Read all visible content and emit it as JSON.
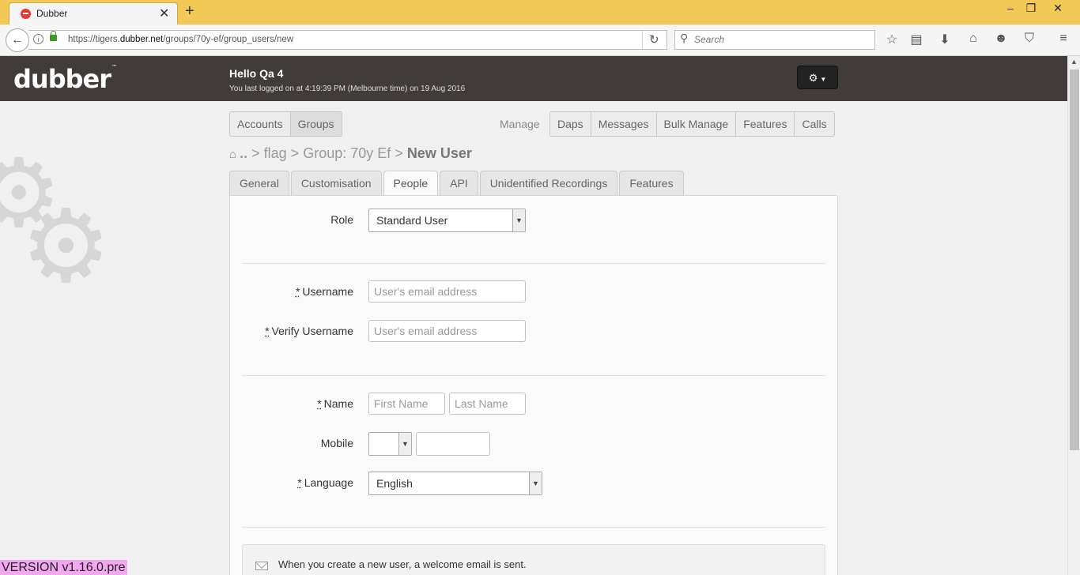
{
  "browser": {
    "tab_title": "Dubber",
    "url_prefix": "https://tigers.",
    "url_domain": "dubber.net",
    "url_path": "/groups/70y-ef/group_users/new",
    "search_placeholder": "Search"
  },
  "header": {
    "logo": "dubber",
    "logo_tm": "™",
    "greeting": "Hello Qa 4",
    "last_login": "You last logged on at 4:19:39 PM (Melbourne time) on 19 Aug 2016"
  },
  "nav": {
    "left": [
      "Accounts",
      "Groups"
    ],
    "manage_label": "Manage",
    "right": [
      "Daps",
      "Messages",
      "Bulk Manage",
      "Features",
      "Calls"
    ]
  },
  "breadcrumb": {
    "parts": [
      "..",
      "flag",
      "Group: 70y Ef"
    ],
    "separator": ">",
    "current": "New User"
  },
  "tabs": [
    "General",
    "Customisation",
    "People",
    "API",
    "Unidentified Recordings",
    "Features"
  ],
  "form": {
    "role_label": "Role",
    "role_value": "Standard User",
    "required_mark": "*",
    "username_label": "Username",
    "username_placeholder": "User's email address",
    "verify_label": "Verify Username",
    "verify_placeholder": "User's email address",
    "name_label": "Name",
    "first_placeholder": "First Name",
    "last_placeholder": "Last Name",
    "mobile_label": "Mobile",
    "language_label": "Language",
    "language_value": "English"
  },
  "notice": "When you create a new user, a welcome email is sent.",
  "version": "VERSION v1.16.0.pre"
}
